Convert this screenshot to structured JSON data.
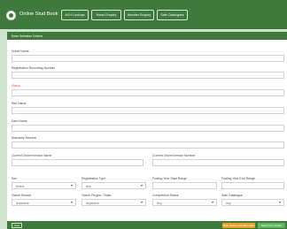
{
  "app": {
    "title": "Online Stud Book",
    "logo_icon": "horse-logo-icon"
  },
  "nav": {
    "tabs": [
      {
        "label": "ACH Lookups"
      },
      {
        "label": "Horse Enquiry"
      },
      {
        "label": "Member Enquiry"
      },
      {
        "label": "Sale Catalogues"
      }
    ]
  },
  "panel": {
    "title": "Enter Selection Criteria"
  },
  "form": {
    "horse_name": {
      "label": "Horse Name",
      "value": ""
    },
    "registration_number": {
      "label": "Registration Recording Number",
      "value": ""
    },
    "status": {
      "label": "Status",
      "value": ""
    },
    "sire_name": {
      "label": "Sire Name",
      "value": ""
    },
    "dam_name": {
      "label": "Dam Name",
      "value": ""
    },
    "microchip": {
      "label": "Microchip Number",
      "value": ""
    },
    "current_owner": {
      "label": "Current Owner/Vendor Name",
      "value": ""
    },
    "current_owner_location": {
      "label": "Current Owner/Vendor Number",
      "value": ""
    },
    "sex": {
      "label": "Sex",
      "value": "Select"
    },
    "registration_type": {
      "label": "Registration Type",
      "value": "Any"
    },
    "foaling_start": {
      "label": "Foaling Year Start Range",
      "value": ""
    },
    "foaling_end": {
      "label": "Foaling Year End Range",
      "value": ""
    },
    "owner_branch": {
      "label": "Owner Branch",
      "value": "Anywhere"
    },
    "owner_region": {
      "label": "Owner Region / State",
      "value": "Anywhere"
    },
    "competition_status": {
      "label": "Competition Status",
      "value": "Any"
    },
    "sale_catalogue": {
      "label": "Sale Catalogue",
      "value": "Any"
    }
  },
  "footer": {
    "clear_label": "Clear",
    "reset_label": "Clear Search and Start Again",
    "search_label": "Search For Horses"
  },
  "colors": {
    "primary": "#3f7a3c",
    "background": "#cfe3cf",
    "warning": "#e9a020",
    "success": "#5cb85c",
    "error_label": "#d9534f"
  }
}
